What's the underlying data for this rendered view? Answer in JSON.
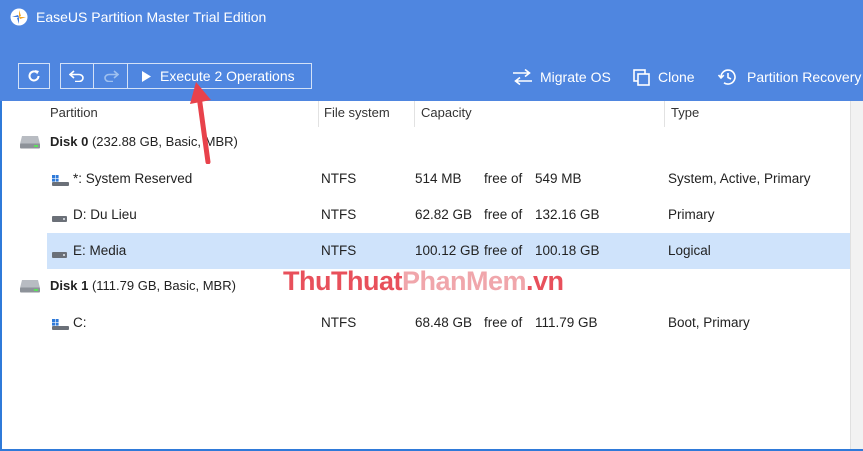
{
  "window": {
    "title": "EaseUS Partition Master Trial Edition"
  },
  "toolbar": {
    "execute_label": "Execute 2 Operations",
    "actions": [
      {
        "label": "Migrate OS",
        "icon": "migrate-icon"
      },
      {
        "label": "Clone",
        "icon": "clone-icon"
      },
      {
        "label": "Partition Recovery",
        "icon": "partition-recovery-icon"
      }
    ]
  },
  "table": {
    "columns": [
      "Partition",
      "File system",
      "Capacity",
      "Type"
    ],
    "disks": [
      {
        "name": "Disk 0",
        "info": "(232.88 GB, Basic, MBR)",
        "partitions": [
          {
            "name": "*: System Reserved",
            "fs": "NTFS",
            "free": "514 MB",
            "free_of": "free of",
            "total": "549 MB",
            "type": "System, Active, Primary",
            "icon": "windows-partition-icon"
          },
          {
            "name": "D: Du Lieu",
            "fs": "NTFS",
            "free": "62.82 GB",
            "free_of": "free of",
            "total": "132.16 GB",
            "type": "Primary",
            "icon": "partition-icon"
          },
          {
            "name": "E: Media",
            "fs": "NTFS",
            "free": "100.12 GB",
            "free_of": "free of",
            "total": "100.18 GB",
            "type": "Logical",
            "icon": "partition-icon",
            "selected": true
          }
        ]
      },
      {
        "name": "Disk 1",
        "info": "(111.79 GB, Basic, MBR)",
        "partitions": [
          {
            "name": "C:",
            "fs": "NTFS",
            "free": "68.48 GB",
            "free_of": "free of",
            "total": "111.79 GB",
            "type": "Boot, Primary",
            "icon": "windows-partition-icon"
          }
        ]
      }
    ]
  },
  "watermark": {
    "part1": "ThuThuat",
    "part2": "PhanMem",
    "part3": ".vn"
  },
  "colors": {
    "toolbar_bg": "#4f86e0",
    "selected_row": "#cfe3fb",
    "arrow": "#e8424b"
  }
}
